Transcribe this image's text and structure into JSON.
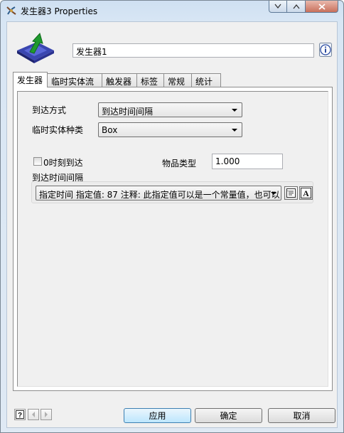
{
  "window": {
    "title": "发生器3 Properties"
  },
  "header": {
    "object_name": "发生器1"
  },
  "tabs": [
    {
      "label": "发生器"
    },
    {
      "label": "临时实体流"
    },
    {
      "label": "触发器"
    },
    {
      "label": "标签"
    },
    {
      "label": "常规"
    },
    {
      "label": "统计"
    }
  ],
  "form": {
    "arrival_mode_label": "到达方式",
    "arrival_mode_value": "到达时间间隔",
    "flowitem_class_label": "临时实体种类",
    "flowitem_class_value": "Box",
    "arrive_at_zero_label": "0时刻到达",
    "arrive_at_zero_checked": false,
    "item_type_label": "物品类型",
    "item_type_value": "1.000",
    "interarrival_label": "到达时间间隔",
    "interarrival_value": "指定时间 指定值: 87 注释: 此指定值可以是一个常量值，也可以"
  },
  "buttons": {
    "apply": "应用",
    "ok": "确定",
    "cancel": "取消"
  },
  "colors": {
    "accent": "#3c7fb1",
    "titlebar": "#cfe0f2"
  }
}
